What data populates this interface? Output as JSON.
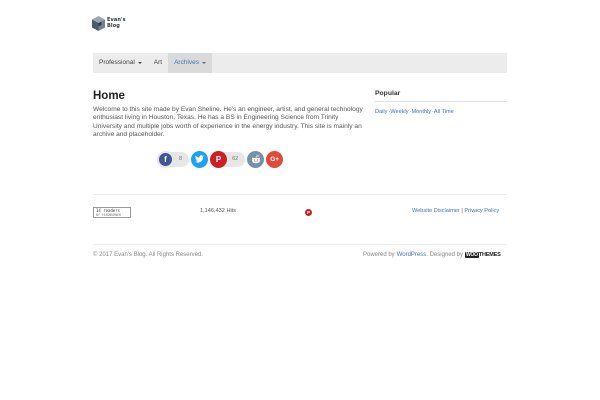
{
  "logo": {
    "line1": "Evan's",
    "line2": "Blog"
  },
  "nav": {
    "items": [
      {
        "label": "Professional",
        "has_dropdown": true,
        "active": false
      },
      {
        "label": "Art",
        "has_dropdown": false,
        "active": false
      },
      {
        "label": "Archives",
        "has_dropdown": true,
        "active": true
      }
    ]
  },
  "main": {
    "title": "Home",
    "intro": "Welcome to this site made by Evan Sheline. He's an engineer, artist, and general technology enthusiast living in Houston, Texas. He has a BS in Engineering Science from Trinity University and multiple jobs worth of experience in the energy industry. This site is mainly an archive and placeholder."
  },
  "share": {
    "facebook": {
      "icon": "facebook-icon",
      "glyph": "f",
      "count": "8",
      "color": "#3b5998"
    },
    "twitter": {
      "icon": "twitter-icon",
      "glyph": "t",
      "color": "#1da1f2"
    },
    "pinterest": {
      "icon": "pinterest-icon",
      "glyph": "P",
      "count": "62",
      "color": "#cb2027"
    },
    "reddit": {
      "icon": "reddit-icon",
      "color": "#7a90a4"
    },
    "googleplus": {
      "icon": "google-plus-icon",
      "glyph": "G+",
      "color": "#dd4b39"
    }
  },
  "sidebar": {
    "title": "Popular",
    "tabs": [
      "Daily",
      "Weekly",
      "Monthly",
      "All Time"
    ]
  },
  "footer_widgets": {
    "readers_badge": {
      "line1": "14 readers",
      "line2": "BY FEEDBURNER"
    },
    "hits": "1,146,432 Hits",
    "links": {
      "disclaimer": "Website Disclaimer",
      "separator": "|",
      "privacy": "Privacy Policy"
    }
  },
  "footer": {
    "copyright": "© 2017 Evan's Blog. All Rights Reserved.",
    "powered_by": "Powered by",
    "wordpress": "WordPress",
    "designed_by": ". Designed by",
    "woo_box": "WOO",
    "woo_text": "THEMES"
  },
  "colors": {
    "accent": "#3b74b8",
    "nav_bg": "#ececec"
  }
}
